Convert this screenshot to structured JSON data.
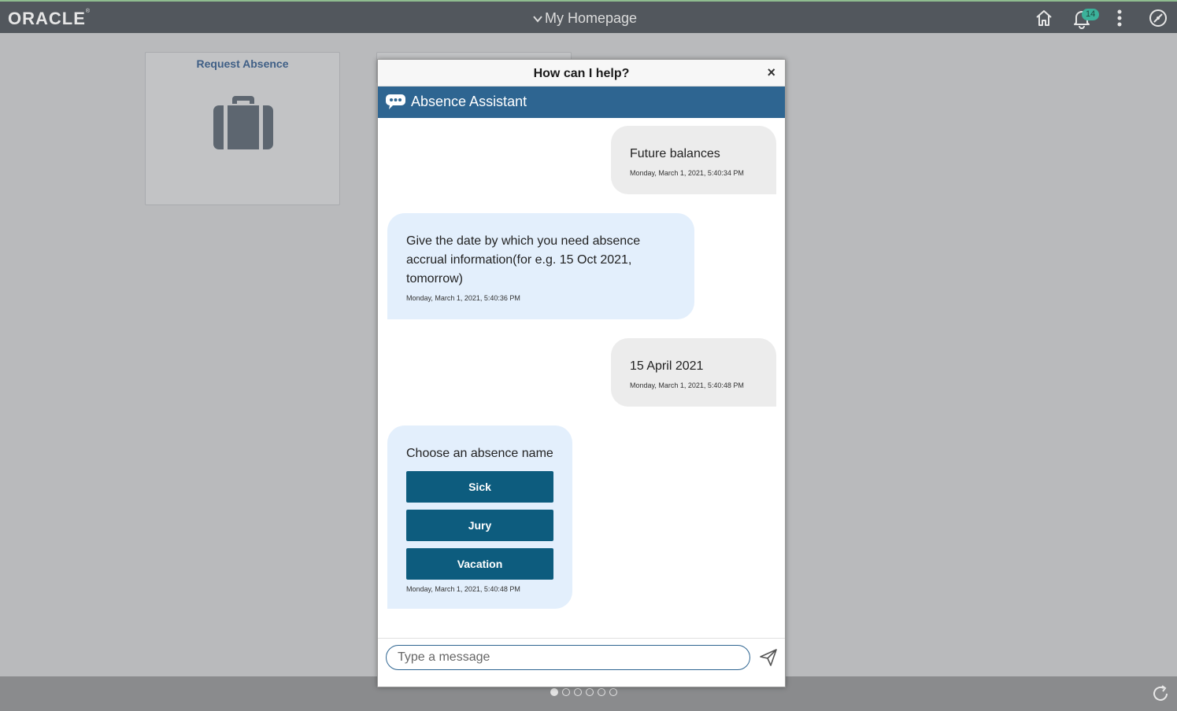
{
  "topbar": {
    "logo": "ORACLE",
    "logo_mark": "®",
    "title": "My Homepage",
    "notification_count": "14",
    "icons": [
      "chevron-down-icon",
      "home-icon",
      "bell-icon",
      "more-vertical-icon",
      "compass-icon"
    ]
  },
  "tiles": [
    {
      "title": "Request Absence",
      "icon": "briefcase-icon"
    }
  ],
  "dialog": {
    "title": "How can I help?",
    "close_label": "×",
    "assistant_name": "Absence Assistant",
    "messages": [
      {
        "from": "user",
        "text": "Future balances",
        "time": "Monday, March 1, 2021, 5:40:34 PM"
      },
      {
        "from": "bot",
        "text": "Give the date by which you need absence accrual information(for e.g. 15 Oct 2021, tomorrow)",
        "time": "Monday, March 1, 2021, 5:40:36 PM"
      },
      {
        "from": "user",
        "text": "15 April 2021",
        "time": "Monday, March 1, 2021, 5:40:48 PM"
      },
      {
        "from": "bot",
        "text": "Choose an absence name",
        "options": [
          "Sick",
          "Jury",
          "Vacation"
        ],
        "time": "Monday, March 1, 2021, 5:40:48 PM"
      }
    ],
    "input": {
      "placeholder": "Type a message",
      "value": ""
    }
  },
  "pager": {
    "count": 6,
    "active": 0
  },
  "colors": {
    "banner": "#52575d",
    "assistant_bar": "#2e6591",
    "choice_button": "#0d5c7e",
    "user_bubble": "#ececec",
    "bot_bubble": "#e3effc"
  }
}
